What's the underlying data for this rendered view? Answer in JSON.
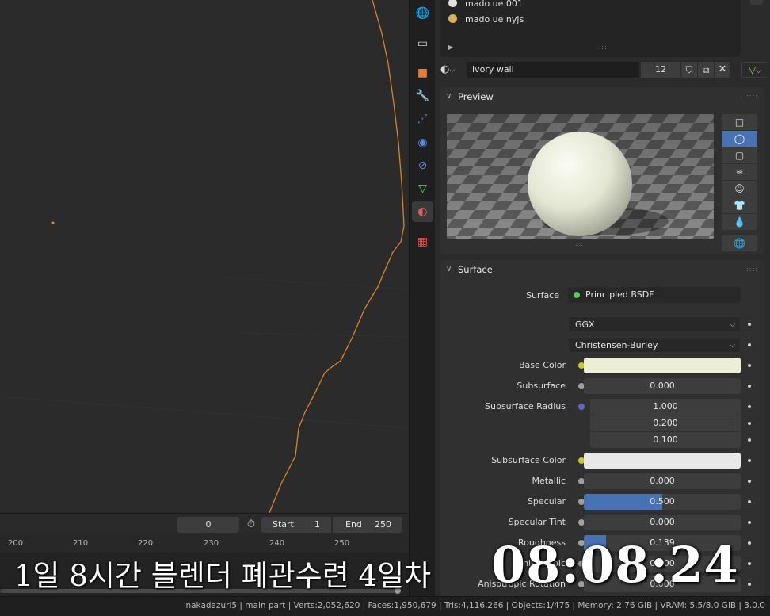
{
  "viewport": {
    "object_outline_color": "#d8832e",
    "origin_color": "#e8883a"
  },
  "timeline": {
    "current_frame": "0",
    "start_label": "Start",
    "start_value": "1",
    "end_label": "End",
    "end_value": "250",
    "ruler_ticks": [
      "200",
      "210",
      "220",
      "230",
      "240",
      "250"
    ],
    "stopwatch_icon": "stopwatch-icon"
  },
  "tabs": [
    {
      "name": "world-tab",
      "icon": "globe-icon",
      "glyph": "🌐",
      "color": "#d05a5a"
    },
    {
      "name": "collection-tab",
      "icon": "collection-box-icon",
      "glyph": "▭",
      "color": "#cfcfcf"
    },
    {
      "name": "object-tab",
      "icon": "object-square-icon",
      "glyph": "■",
      "color": "#e08038"
    },
    {
      "name": "modifier-tab",
      "icon": "wrench-icon",
      "glyph": "🔧",
      "color": "#5a8ad8"
    },
    {
      "name": "particles-tab",
      "icon": "particles-icon",
      "glyph": "⋰",
      "color": "#5a8ad8"
    },
    {
      "name": "physics-tab",
      "icon": "physics-orbit-icon",
      "glyph": "◉",
      "color": "#5a8ad8"
    },
    {
      "name": "constraints-tab",
      "icon": "constraint-icon",
      "glyph": "⊘",
      "color": "#5a8ad8"
    },
    {
      "name": "data-tab",
      "icon": "mesh-data-icon",
      "glyph": "▽",
      "color": "#5ad85a"
    },
    {
      "name": "material-tab",
      "icon": "material-sphere-icon",
      "glyph": "◐",
      "color": "#e06060"
    },
    {
      "name": "texture-tab",
      "icon": "texture-checker-icon",
      "glyph": "▦",
      "color": "#d05a5a"
    }
  ],
  "material_slots": [
    {
      "name": "mado ue.001",
      "color": "#e0e0e0"
    },
    {
      "name": "mado ue nyjs",
      "color": "#d8b25a"
    }
  ],
  "material": {
    "name": "ivory wall",
    "users": "12"
  },
  "preview": {
    "title": "Preview",
    "modes": [
      "flat-preview",
      "sphere-preview",
      "cube-preview",
      "hair-preview",
      "monkey-preview",
      "cloth-preview",
      "fluid-preview"
    ],
    "mode_glyphs": [
      "□",
      "◯",
      "▢",
      "≋",
      "☺",
      "👕",
      "💧"
    ],
    "active_mode": 1,
    "world_glyph": "🌐"
  },
  "surface": {
    "title": "Surface",
    "surface_label": "Surface",
    "shader": "Principled BSDF",
    "shader_color": "#5ac85a",
    "distribution": "GGX",
    "subsurface_method": "Christensen-Burley",
    "rows": [
      {
        "label": "Base Color",
        "type": "color",
        "socket": "#c8c832",
        "swatch": "#ecefd6"
      },
      {
        "label": "Subsurface",
        "type": "value",
        "socket": "#a0a0a0",
        "value": "0.000"
      },
      {
        "label": "Subsurface Radius",
        "type": "vector",
        "socket": "#6464c8",
        "values": [
          "1.000",
          "0.200",
          "0.100"
        ]
      },
      {
        "label": "Subsurface Color",
        "type": "color",
        "socket": "#c8c832",
        "swatch": "#e8e8e8"
      },
      {
        "label": "Metallic",
        "type": "value",
        "socket": "#a0a0a0",
        "value": "0.000"
      },
      {
        "label": "Specular",
        "type": "slider",
        "socket": "#a0a0a0",
        "value": "0.500",
        "fraction": 0.5
      },
      {
        "label": "Specular Tint",
        "type": "value",
        "socket": "#a0a0a0",
        "value": "0.000"
      },
      {
        "label": "Roughness",
        "type": "slider",
        "socket": "#a0a0a0",
        "value": "0.139",
        "fraction": 0.139
      },
      {
        "label": "Anisotropic",
        "type": "value",
        "socket": "#a0a0a0",
        "value": "0.000"
      },
      {
        "label": "Anisotropic Rotation",
        "type": "value",
        "socket": "#a0a0a0",
        "value": "0.000"
      }
    ]
  },
  "status_bar": "nakadazuri5 | main part | Verts:2,052,620 | Faces:1,950,679 | Tris:4,116,266 | Objects:1/475 | Memory: 2.76 GiB | VRAM: 5.5/8.0 GiB | 3.0.0",
  "overlay": {
    "caption": "1일 8시간 블렌더 폐관수련 4일차",
    "clock": "08:08:24"
  }
}
